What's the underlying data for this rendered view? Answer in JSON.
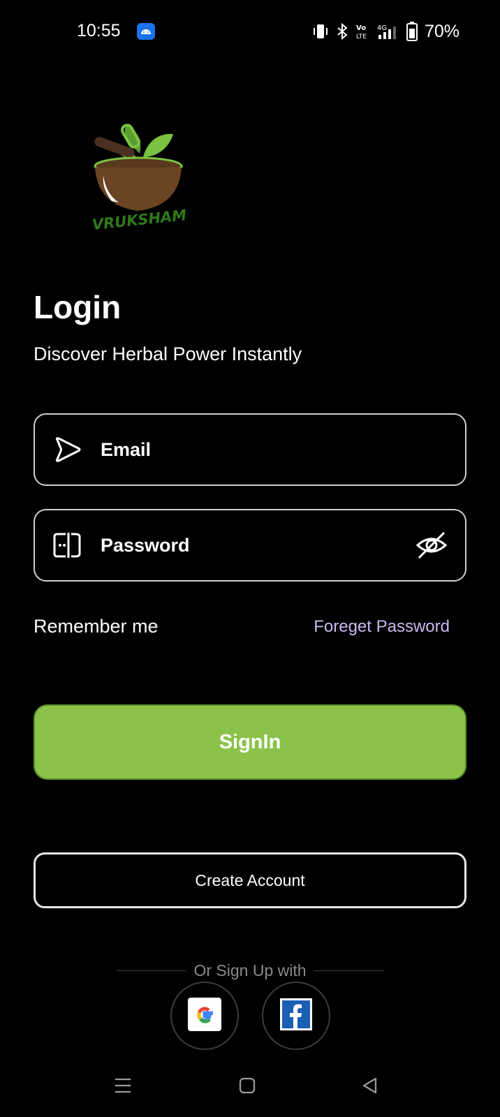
{
  "status_bar": {
    "time": "10:55",
    "battery": "70%",
    "icons": [
      "android-notification-icon",
      "vibrate-icon",
      "bluetooth-icon",
      "volte-icon",
      "signal-4g-icon",
      "battery-icon"
    ]
  },
  "logo": {
    "text": "VRUKSHAM"
  },
  "header": {
    "title": "Login",
    "subtitle": "Discover Herbal Power Instantly"
  },
  "form": {
    "email_placeholder": "Email",
    "password_placeholder": "Password",
    "remember_label": "Remember me",
    "forgot_label": "Foreget Password"
  },
  "buttons": {
    "signin_label": "SignIn",
    "create_account_label": "Create Account"
  },
  "social": {
    "divider_text": "Or Sign Up with",
    "providers": [
      "google",
      "facebook"
    ]
  },
  "colors": {
    "background": "#000000",
    "accent_green": "#8bc34a",
    "link_purple": "#c9b8f0"
  }
}
